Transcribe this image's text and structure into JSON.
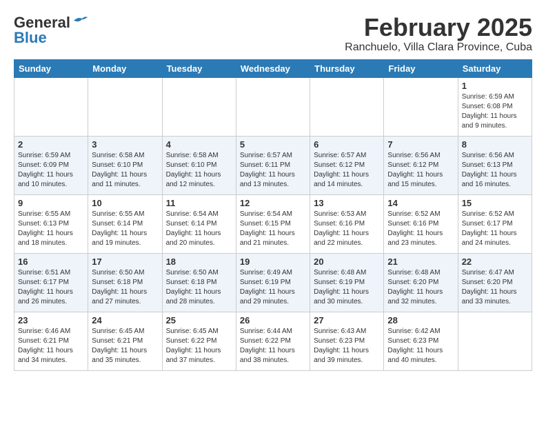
{
  "header": {
    "logo_general": "General",
    "logo_blue": "Blue",
    "month_title": "February 2025",
    "subtitle": "Ranchuelo, Villa Clara Province, Cuba"
  },
  "days_of_week": [
    "Sunday",
    "Monday",
    "Tuesday",
    "Wednesday",
    "Thursday",
    "Friday",
    "Saturday"
  ],
  "weeks": [
    {
      "row_class": "row-odd",
      "days": [
        {
          "num": "",
          "info": ""
        },
        {
          "num": "",
          "info": ""
        },
        {
          "num": "",
          "info": ""
        },
        {
          "num": "",
          "info": ""
        },
        {
          "num": "",
          "info": ""
        },
        {
          "num": "",
          "info": ""
        },
        {
          "num": "1",
          "info": "Sunrise: 6:59 AM\nSunset: 6:08 PM\nDaylight: 11 hours\nand 9 minutes."
        }
      ]
    },
    {
      "row_class": "row-even",
      "days": [
        {
          "num": "2",
          "info": "Sunrise: 6:59 AM\nSunset: 6:09 PM\nDaylight: 11 hours\nand 10 minutes."
        },
        {
          "num": "3",
          "info": "Sunrise: 6:58 AM\nSunset: 6:10 PM\nDaylight: 11 hours\nand 11 minutes."
        },
        {
          "num": "4",
          "info": "Sunrise: 6:58 AM\nSunset: 6:10 PM\nDaylight: 11 hours\nand 12 minutes."
        },
        {
          "num": "5",
          "info": "Sunrise: 6:57 AM\nSunset: 6:11 PM\nDaylight: 11 hours\nand 13 minutes."
        },
        {
          "num": "6",
          "info": "Sunrise: 6:57 AM\nSunset: 6:12 PM\nDaylight: 11 hours\nand 14 minutes."
        },
        {
          "num": "7",
          "info": "Sunrise: 6:56 AM\nSunset: 6:12 PM\nDaylight: 11 hours\nand 15 minutes."
        },
        {
          "num": "8",
          "info": "Sunrise: 6:56 AM\nSunset: 6:13 PM\nDaylight: 11 hours\nand 16 minutes."
        }
      ]
    },
    {
      "row_class": "row-odd",
      "days": [
        {
          "num": "9",
          "info": "Sunrise: 6:55 AM\nSunset: 6:13 PM\nDaylight: 11 hours\nand 18 minutes."
        },
        {
          "num": "10",
          "info": "Sunrise: 6:55 AM\nSunset: 6:14 PM\nDaylight: 11 hours\nand 19 minutes."
        },
        {
          "num": "11",
          "info": "Sunrise: 6:54 AM\nSunset: 6:14 PM\nDaylight: 11 hours\nand 20 minutes."
        },
        {
          "num": "12",
          "info": "Sunrise: 6:54 AM\nSunset: 6:15 PM\nDaylight: 11 hours\nand 21 minutes."
        },
        {
          "num": "13",
          "info": "Sunrise: 6:53 AM\nSunset: 6:16 PM\nDaylight: 11 hours\nand 22 minutes."
        },
        {
          "num": "14",
          "info": "Sunrise: 6:52 AM\nSunset: 6:16 PM\nDaylight: 11 hours\nand 23 minutes."
        },
        {
          "num": "15",
          "info": "Sunrise: 6:52 AM\nSunset: 6:17 PM\nDaylight: 11 hours\nand 24 minutes."
        }
      ]
    },
    {
      "row_class": "row-even",
      "days": [
        {
          "num": "16",
          "info": "Sunrise: 6:51 AM\nSunset: 6:17 PM\nDaylight: 11 hours\nand 26 minutes."
        },
        {
          "num": "17",
          "info": "Sunrise: 6:50 AM\nSunset: 6:18 PM\nDaylight: 11 hours\nand 27 minutes."
        },
        {
          "num": "18",
          "info": "Sunrise: 6:50 AM\nSunset: 6:18 PM\nDaylight: 11 hours\nand 28 minutes."
        },
        {
          "num": "19",
          "info": "Sunrise: 6:49 AM\nSunset: 6:19 PM\nDaylight: 11 hours\nand 29 minutes."
        },
        {
          "num": "20",
          "info": "Sunrise: 6:48 AM\nSunset: 6:19 PM\nDaylight: 11 hours\nand 30 minutes."
        },
        {
          "num": "21",
          "info": "Sunrise: 6:48 AM\nSunset: 6:20 PM\nDaylight: 11 hours\nand 32 minutes."
        },
        {
          "num": "22",
          "info": "Sunrise: 6:47 AM\nSunset: 6:20 PM\nDaylight: 11 hours\nand 33 minutes."
        }
      ]
    },
    {
      "row_class": "row-odd",
      "days": [
        {
          "num": "23",
          "info": "Sunrise: 6:46 AM\nSunset: 6:21 PM\nDaylight: 11 hours\nand 34 minutes."
        },
        {
          "num": "24",
          "info": "Sunrise: 6:45 AM\nSunset: 6:21 PM\nDaylight: 11 hours\nand 35 minutes."
        },
        {
          "num": "25",
          "info": "Sunrise: 6:45 AM\nSunset: 6:22 PM\nDaylight: 11 hours\nand 37 minutes."
        },
        {
          "num": "26",
          "info": "Sunrise: 6:44 AM\nSunset: 6:22 PM\nDaylight: 11 hours\nand 38 minutes."
        },
        {
          "num": "27",
          "info": "Sunrise: 6:43 AM\nSunset: 6:23 PM\nDaylight: 11 hours\nand 39 minutes."
        },
        {
          "num": "28",
          "info": "Sunrise: 6:42 AM\nSunset: 6:23 PM\nDaylight: 11 hours\nand 40 minutes."
        },
        {
          "num": "",
          "info": ""
        }
      ]
    }
  ]
}
